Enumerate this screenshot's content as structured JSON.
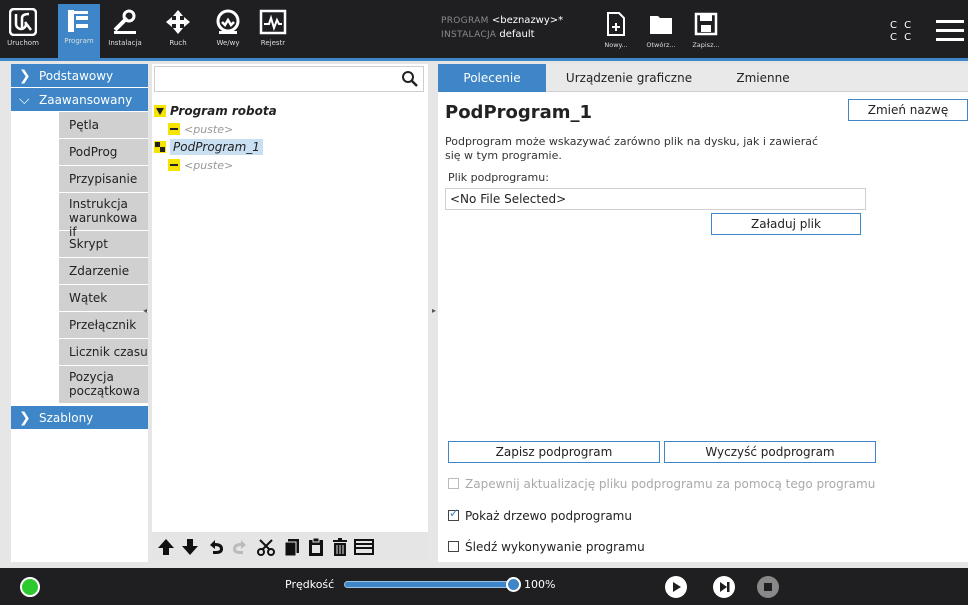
{
  "topbar": {
    "nav": [
      {
        "label": "Uruchom",
        "icon": "ur-logo-icon"
      },
      {
        "label": "Program",
        "icon": "program-icon"
      },
      {
        "label": "Instalacja",
        "icon": "installation-icon"
      },
      {
        "label": "Ruch",
        "icon": "move-icon"
      },
      {
        "label": "We/wy",
        "icon": "io-icon"
      },
      {
        "label": "Rejestr",
        "icon": "log-icon"
      }
    ],
    "program_key": "PROGRAM",
    "program_value": "<beznazwy>*",
    "installation_key": "INSTALACJA",
    "installation_value": "default",
    "file_actions": [
      {
        "label": "Nowy...",
        "icon": "new-file-icon"
      },
      {
        "label": "Otwórz...",
        "icon": "folder-icon"
      },
      {
        "label": "Zapisz...",
        "icon": "save-icon"
      }
    ],
    "cc_line1": "C C",
    "cc_line2": "C C"
  },
  "leftnav": {
    "basic": "Podstawowy",
    "advanced": "Zaawansowany",
    "items": [
      "Pętla",
      "PodProg",
      "Przypisanie",
      "Instrukcja warunkowa if",
      "Skrypt",
      "Zdarzenie",
      "Wątek",
      "Przełącznik",
      "Licznik czasu",
      "Pozycja początkowa"
    ],
    "templates": "Szablony"
  },
  "tree": {
    "search_placeholder": "",
    "root": "Program robota",
    "root_child": "<puste>",
    "subprogram": "PodProgram_1",
    "subprogram_child": "<puste>"
  },
  "tabs": [
    "Polecenie",
    "Urządzenie graficzne",
    "Zmienne"
  ],
  "command": {
    "title": "PodProgram_1",
    "rename_button": "Zmień nazwę",
    "description_line1": "Podprogram może wskazywać zarówno plik na dysku, jak i zawierać",
    "description_line2": "się w tym programie.",
    "file_label": "Plik podprogramu:",
    "file_value": "<No File Selected>",
    "load_button": "Załaduj plik",
    "save_button": "Zapisz podprogram",
    "clear_button": "Wyczyść podprogram",
    "check_keep_updated": "Zapewnij aktualizację pliku podprogramu za pomocą tego programu",
    "check_keep_updated_state": false,
    "check_show_tree": "Pokaż drzewo podprogramu",
    "check_show_tree_state": true,
    "check_follow": "Śledź wykonywanie programu",
    "check_follow_state": false
  },
  "bottombar": {
    "speed_label": "Prędkość",
    "speed_value": "100%",
    "speed_fraction": 1.0
  },
  "colors": {
    "accent": "#3e86c7",
    "topbar": "#1f1f22",
    "power_on": "#2ec92e",
    "node_yellow": "#f5e400"
  }
}
